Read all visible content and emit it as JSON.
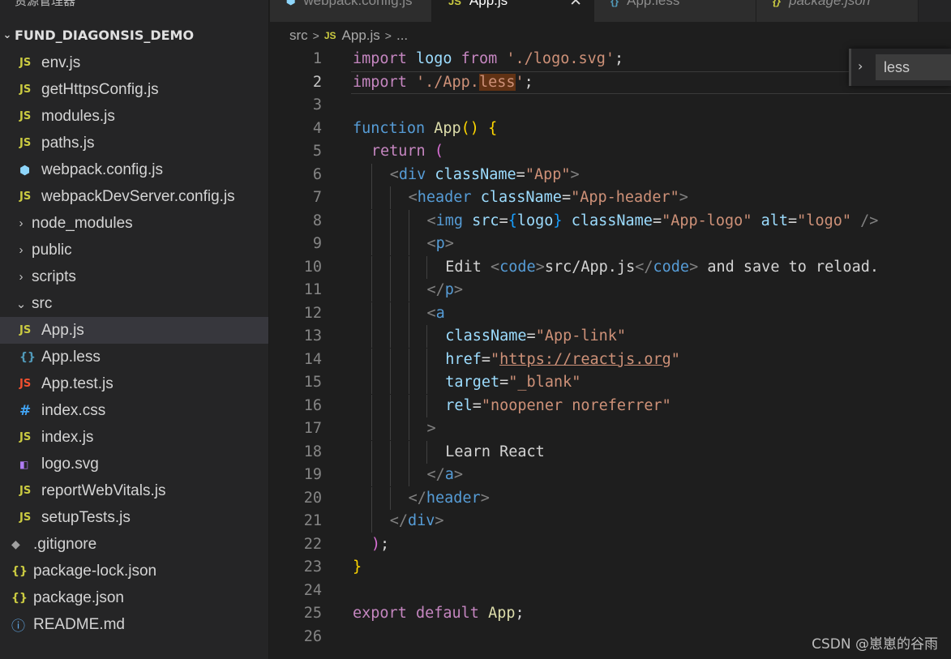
{
  "sidebar": {
    "title": "资源管理器",
    "more": "···",
    "project": "FUND_DIAGONSIS_DEMO",
    "items": [
      {
        "label": "env.js",
        "icon": "JS",
        "icon_name": "js-file-icon",
        "kind": "js",
        "depth": 1
      },
      {
        "label": "getHttpsConfig.js",
        "icon": "JS",
        "icon_name": "js-file-icon",
        "kind": "js",
        "depth": 1
      },
      {
        "label": "modules.js",
        "icon": "JS",
        "icon_name": "js-file-icon",
        "kind": "js",
        "depth": 1
      },
      {
        "label": "paths.js",
        "icon": "JS",
        "icon_name": "js-file-icon",
        "kind": "js",
        "depth": 1
      },
      {
        "label": "webpack.config.js",
        "icon": "⬢",
        "icon_name": "webpack-icon",
        "kind": "webpack",
        "depth": 1
      },
      {
        "label": "webpackDevServer.config.js",
        "icon": "JS",
        "icon_name": "js-file-icon",
        "kind": "js",
        "depth": 1
      },
      {
        "label": "node_modules",
        "icon": "›",
        "icon_name": "chevron-right-icon",
        "kind": "folder",
        "depth": 0
      },
      {
        "label": "public",
        "icon": "›",
        "icon_name": "chevron-right-icon",
        "kind": "folder",
        "depth": 0
      },
      {
        "label": "scripts",
        "icon": "›",
        "icon_name": "chevron-right-icon",
        "kind": "folder",
        "depth": 0
      },
      {
        "label": "src",
        "icon": "⌄",
        "icon_name": "chevron-down-icon",
        "kind": "folder",
        "depth": 0
      },
      {
        "label": "App.js",
        "icon": "JS",
        "icon_name": "js-file-icon",
        "kind": "js",
        "depth": 1,
        "selected": true
      },
      {
        "label": "App.less",
        "icon": "{}",
        "icon_name": "less-file-icon",
        "kind": "less",
        "depth": 1
      },
      {
        "label": "App.test.js",
        "icon": "JS",
        "icon_name": "test-file-icon",
        "kind": "test",
        "depth": 1
      },
      {
        "label": "index.css",
        "icon": "#",
        "icon_name": "css-file-icon",
        "kind": "css",
        "depth": 1
      },
      {
        "label": "index.js",
        "icon": "JS",
        "icon_name": "js-file-icon",
        "kind": "js",
        "depth": 1
      },
      {
        "label": "logo.svg",
        "icon": "◧",
        "icon_name": "svg-file-icon",
        "kind": "svg",
        "depth": 1
      },
      {
        "label": "reportWebVitals.js",
        "icon": "JS",
        "icon_name": "js-file-icon",
        "kind": "js",
        "depth": 1
      },
      {
        "label": "setupTests.js",
        "icon": "JS",
        "icon_name": "js-file-icon",
        "kind": "js",
        "depth": 1
      },
      {
        "label": ".gitignore",
        "icon": "◆",
        "icon_name": "git-icon",
        "kind": "git",
        "depth": 0
      },
      {
        "label": "package-lock.json",
        "icon": "{}",
        "icon_name": "json-file-icon",
        "kind": "json",
        "depth": 0
      },
      {
        "label": "package.json",
        "icon": "{}",
        "icon_name": "json-file-icon",
        "kind": "json",
        "depth": 0
      },
      {
        "label": "README.md",
        "icon": "ⓘ",
        "icon_name": "info-icon",
        "kind": "info",
        "depth": 0
      }
    ]
  },
  "tabs": [
    {
      "label": "webpack.config.js",
      "icon": "⬢",
      "icon_color": "#8ed6fb",
      "icon_name": "webpack-icon"
    },
    {
      "label": "App.js",
      "icon": "JS",
      "icon_color": "#cbcb41",
      "icon_name": "js-file-icon",
      "active": true,
      "close": "✕"
    },
    {
      "label": "App.less",
      "icon": "{}",
      "icon_color": "#519aba",
      "icon_name": "less-file-icon"
    },
    {
      "label": "package.json",
      "icon": "{}",
      "icon_color": "#cbcb41",
      "icon_name": "json-file-icon",
      "italic": true
    }
  ],
  "breadcrumb": {
    "folder": "src",
    "sep": ">",
    "file_icon": "JS",
    "file": "App.js",
    "more": "..."
  },
  "editor": {
    "current_line": 2,
    "lines": [
      {
        "n": "1",
        "indent": 0,
        "tokens": [
          [
            "import",
            "kw"
          ],
          [
            " ",
            "tx"
          ],
          [
            "logo",
            "vr"
          ],
          [
            " ",
            "tx"
          ],
          [
            "from",
            "kw"
          ],
          [
            " ",
            "tx"
          ],
          [
            "'./logo.svg'",
            "st"
          ],
          [
            ";",
            "tx"
          ]
        ]
      },
      {
        "n": "2",
        "indent": 0,
        "tokens": [
          [
            "import",
            "kw"
          ],
          [
            " ",
            "tx"
          ],
          [
            "'./App.",
            "st"
          ],
          [
            "less",
            "st hl"
          ],
          [
            "'",
            "st"
          ],
          [
            ";",
            "tx"
          ]
        ]
      },
      {
        "n": "3",
        "indent": 0,
        "tokens": []
      },
      {
        "n": "4",
        "indent": 0,
        "tokens": [
          [
            "function",
            "kw2"
          ],
          [
            " ",
            "tx"
          ],
          [
            "App",
            "fn"
          ],
          [
            "()",
            "br"
          ],
          [
            " ",
            "tx"
          ],
          [
            "{",
            "br"
          ]
        ]
      },
      {
        "n": "5",
        "indent": 1,
        "tokens": [
          [
            "return",
            "kw"
          ],
          [
            " ",
            "tx"
          ],
          [
            "(",
            "br2"
          ]
        ]
      },
      {
        "n": "6",
        "indent": 2,
        "tokens": [
          [
            "<",
            "pt"
          ],
          [
            "div",
            "tg"
          ],
          [
            " ",
            "tx"
          ],
          [
            "className",
            "vr"
          ],
          [
            "=",
            "tx"
          ],
          [
            "\"App\"",
            "st"
          ],
          [
            ">",
            "pt"
          ]
        ]
      },
      {
        "n": "7",
        "indent": 3,
        "tokens": [
          [
            "<",
            "pt"
          ],
          [
            "header",
            "tg"
          ],
          [
            " ",
            "tx"
          ],
          [
            "className",
            "vr"
          ],
          [
            "=",
            "tx"
          ],
          [
            "\"App-header\"",
            "st"
          ],
          [
            ">",
            "pt"
          ]
        ]
      },
      {
        "n": "8",
        "indent": 4,
        "tokens": [
          [
            "<",
            "pt"
          ],
          [
            "img",
            "tg"
          ],
          [
            " ",
            "tx"
          ],
          [
            "src",
            "vr"
          ],
          [
            "=",
            "tx"
          ],
          [
            "{",
            "br3"
          ],
          [
            "logo",
            "vr"
          ],
          [
            "}",
            "br3"
          ],
          [
            " ",
            "tx"
          ],
          [
            "className",
            "vr"
          ],
          [
            "=",
            "tx"
          ],
          [
            "\"App-logo\"",
            "st"
          ],
          [
            " ",
            "tx"
          ],
          [
            "alt",
            "vr"
          ],
          [
            "=",
            "tx"
          ],
          [
            "\"logo\"",
            "st"
          ],
          [
            " ",
            "tx"
          ],
          [
            "/>",
            "pt"
          ]
        ]
      },
      {
        "n": "9",
        "indent": 4,
        "tokens": [
          [
            "<",
            "pt"
          ],
          [
            "p",
            "tg"
          ],
          [
            ">",
            "pt"
          ]
        ]
      },
      {
        "n": "10",
        "indent": 5,
        "tokens": [
          [
            "Edit ",
            "tx"
          ],
          [
            "<",
            "pt"
          ],
          [
            "code",
            "tg"
          ],
          [
            ">",
            "pt"
          ],
          [
            "src/App.js",
            "tx"
          ],
          [
            "</",
            "pt"
          ],
          [
            "code",
            "tg"
          ],
          [
            ">",
            "pt"
          ],
          [
            " and save to reload.",
            "tx"
          ]
        ]
      },
      {
        "n": "11",
        "indent": 4,
        "tokens": [
          [
            "</",
            "pt"
          ],
          [
            "p",
            "tg"
          ],
          [
            ">",
            "pt"
          ]
        ]
      },
      {
        "n": "12",
        "indent": 4,
        "tokens": [
          [
            "<",
            "pt"
          ],
          [
            "a",
            "tg"
          ]
        ]
      },
      {
        "n": "13",
        "indent": 5,
        "tokens": [
          [
            "className",
            "vr"
          ],
          [
            "=",
            "tx"
          ],
          [
            "\"App-link\"",
            "st"
          ]
        ]
      },
      {
        "n": "14",
        "indent": 5,
        "tokens": [
          [
            "href",
            "vr"
          ],
          [
            "=",
            "tx"
          ],
          [
            "\"",
            "st"
          ],
          [
            "https://reactjs.org",
            "st ul"
          ],
          [
            "\"",
            "st"
          ]
        ]
      },
      {
        "n": "15",
        "indent": 5,
        "tokens": [
          [
            "target",
            "vr"
          ],
          [
            "=",
            "tx"
          ],
          [
            "\"_blank\"",
            "st"
          ]
        ]
      },
      {
        "n": "16",
        "indent": 5,
        "tokens": [
          [
            "rel",
            "vr"
          ],
          [
            "=",
            "tx"
          ],
          [
            "\"noopener noreferrer\"",
            "st"
          ]
        ]
      },
      {
        "n": "17",
        "indent": 4,
        "tokens": [
          [
            ">",
            "pt"
          ]
        ]
      },
      {
        "n": "18",
        "indent": 5,
        "tokens": [
          [
            "Learn React",
            "tx"
          ]
        ]
      },
      {
        "n": "19",
        "indent": 4,
        "tokens": [
          [
            "</",
            "pt"
          ],
          [
            "a",
            "tg"
          ],
          [
            ">",
            "pt"
          ]
        ]
      },
      {
        "n": "20",
        "indent": 3,
        "tokens": [
          [
            "</",
            "pt"
          ],
          [
            "header",
            "tg"
          ],
          [
            ">",
            "pt"
          ]
        ]
      },
      {
        "n": "21",
        "indent": 2,
        "tokens": [
          [
            "</",
            "pt"
          ],
          [
            "div",
            "tg"
          ],
          [
            ">",
            "pt"
          ]
        ]
      },
      {
        "n": "22",
        "indent": 1,
        "tokens": [
          [
            ")",
            "br2"
          ],
          [
            ";",
            "tx"
          ]
        ]
      },
      {
        "n": "23",
        "indent": 0,
        "tokens": [
          [
            "}",
            "br"
          ]
        ]
      },
      {
        "n": "24",
        "indent": 0,
        "tokens": []
      },
      {
        "n": "25",
        "indent": 0,
        "tokens": [
          [
            "export",
            "kw"
          ],
          [
            " ",
            "tx"
          ],
          [
            "default",
            "kw"
          ],
          [
            " ",
            "tx"
          ],
          [
            "App",
            "fn"
          ],
          [
            ";",
            "tx"
          ]
        ]
      },
      {
        "n": "26",
        "indent": 0,
        "tokens": []
      }
    ]
  },
  "find": {
    "toggle": "›",
    "value": "less"
  },
  "watermark": "CSDN @崽崽的谷雨",
  "colors": {
    "editor_bg": "#1e1e1e",
    "sidebar_bg": "#252526",
    "selection": "#37373d",
    "find_match": "#613214"
  }
}
